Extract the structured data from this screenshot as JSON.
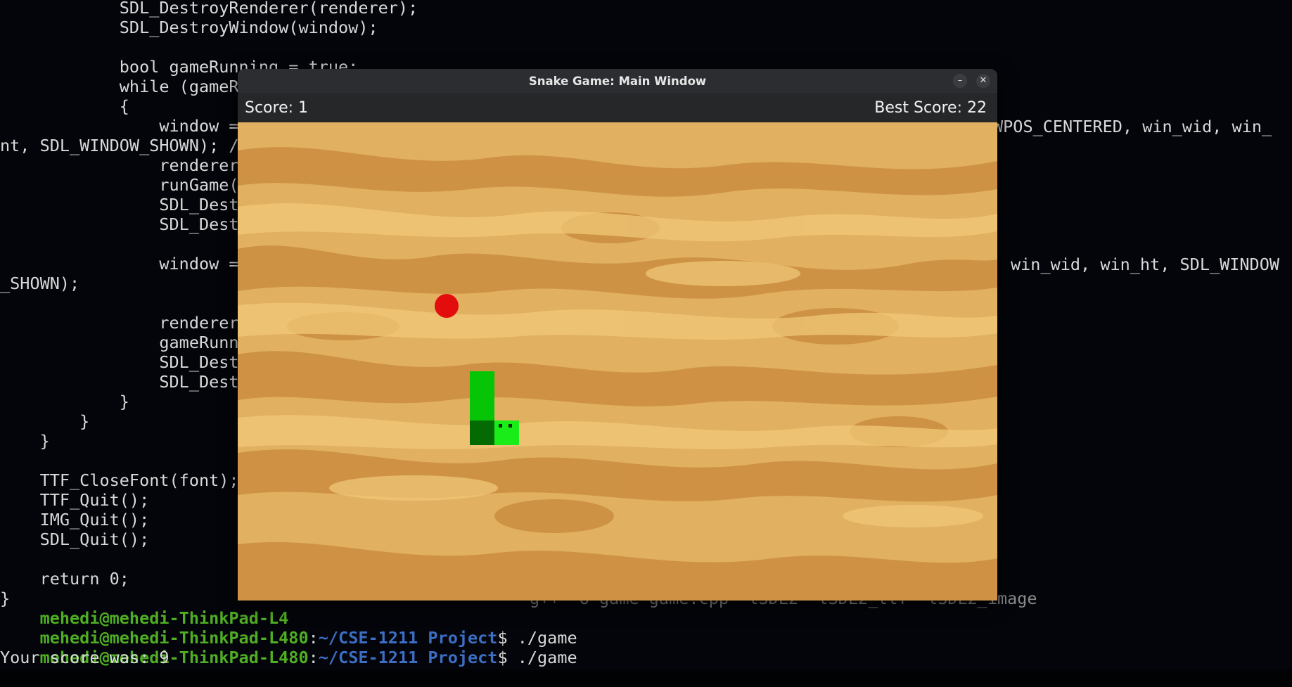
{
  "terminal": {
    "code_lines": [
      "            SDL_DestroyRenderer(renderer);",
      "            SDL_DestroyWindow(window);",
      "",
      "            bool gameRunning = true;",
      "            while (gameRu",
      "            {",
      "                window =",
      "nt, SDL_WINDOW_SHOWN); //",
      "                renderer",
      "                runGame(r",
      "                SDL_Destr",
      "                SDL_Destr",
      "",
      "                window =",
      "_SHOWN);",
      "",
      "                renderer",
      "                gameRunni",
      "                SDL_Destr",
      "                SDL_Destr",
      "            }",
      "        }",
      "    }",
      "",
      "    TTF_CloseFont(font);",
      "    TTF_Quit();",
      "    IMG_Quit();",
      "    SDL_Quit();",
      "",
      "    return 0;",
      "}"
    ],
    "right_fragment_1": "WPOS_CENTERED, win_wid, win_",
    "right_fragment_2": "win_wid, win_ht, SDL_WINDOW",
    "prompt_user": "mehedi@mehedi-ThinkPad-L480",
    "prompt_sep": ":",
    "prompt_path": "~/CSE-1211 Project",
    "prompt_dollar": "$",
    "partial_prompt": "mehedi@mehedi-ThinkPad-L4",
    "partial_command_tail": "g++ -o game game.cpp -lSDL2 -lSDL2_ttf -lSDL2_image",
    "command_run": " ./game",
    "output_line": "Your score was: 9"
  },
  "window": {
    "title": "Snake Game: Main Window",
    "minimize_symbol": "–",
    "close_symbol": "✕"
  },
  "game": {
    "score_label": "Score: 1",
    "best_score_label": "Best Score: 22",
    "colors": {
      "food": "#e30d0d",
      "snake_body": "#06c406",
      "snake_body_dark": "#046b04",
      "snake_head": "#19ec19",
      "sand_light": "#e8be68",
      "sand_dark": "#c8893c"
    }
  }
}
